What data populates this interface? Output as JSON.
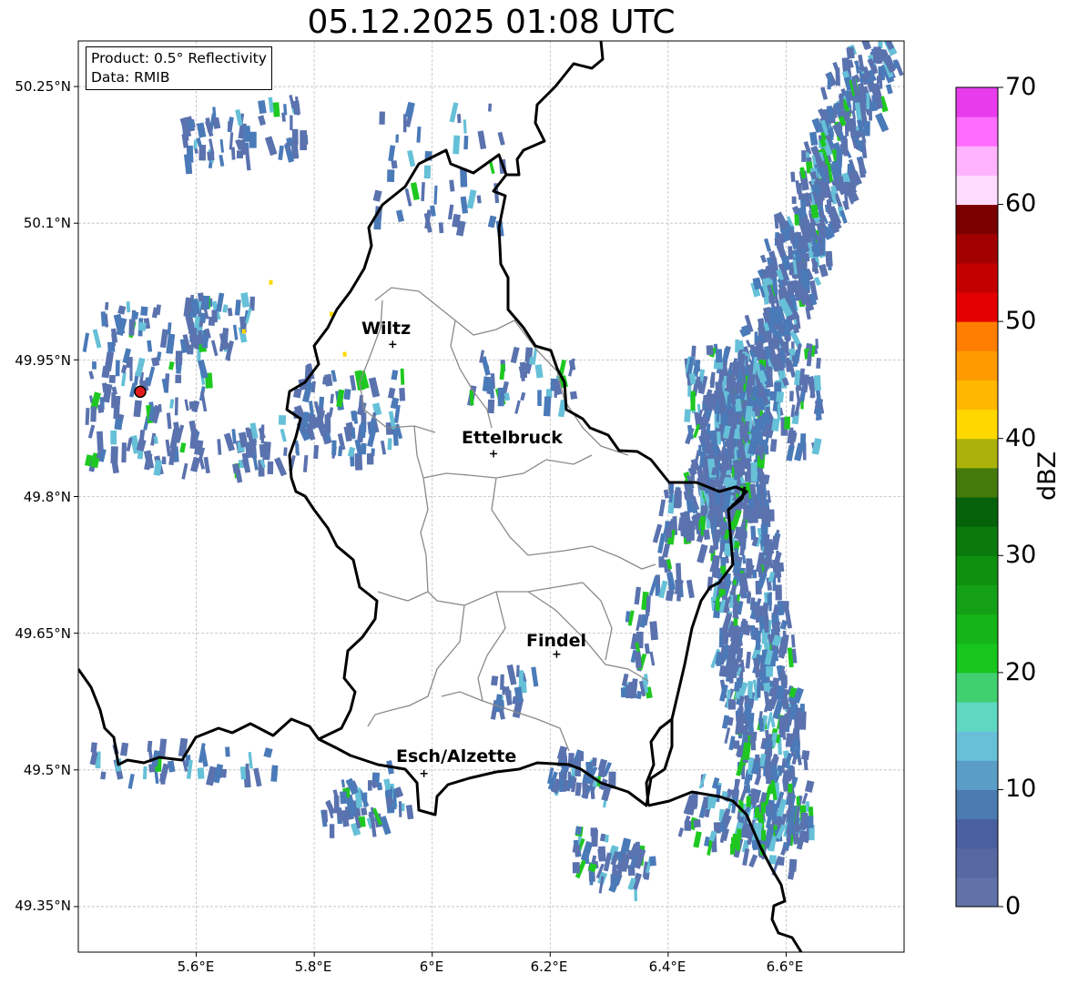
{
  "title": "05.12.2025 01:08 UTC",
  "info_box": {
    "product": "Product: 0.5° Reflectivity",
    "data": "Data: RMIB"
  },
  "lat_labels": [
    "50.25°N",
    "50.1°N",
    "49.95°N",
    "49.8°N",
    "49.65°N",
    "49.5°N",
    "49.35°N"
  ],
  "lon_labels": [
    "5.6°E",
    "5.8°E",
    "6°E",
    "6.2°E",
    "6.4°E",
    "6.6°E"
  ],
  "cities": [
    {
      "name": "Wiltz",
      "lat": 49.967,
      "lon": 5.933
    },
    {
      "name": "Ettelbruck",
      "lat": 49.847,
      "lon": 6.104
    },
    {
      "name": "Findel",
      "lat": 49.627,
      "lon": 6.211
    },
    {
      "name": "Esch/Alzette",
      "lat": 49.496,
      "lon": 5.986
    }
  ],
  "radar_site": {
    "lat": 49.915,
    "lon": 5.505
  },
  "map_extent": {
    "lon_min": 5.4,
    "lon_max": 6.8,
    "lat_min": 49.3,
    "lat_max": 50.3
  },
  "colorbar": {
    "label": "dBZ",
    "ticks": [
      "0",
      "10",
      "20",
      "30",
      "40",
      "50",
      "60",
      "70"
    ],
    "colors": [
      "#6272a8",
      "#5568a2",
      "#4a5fa0",
      "#4a7ab0",
      "#5a9ec8",
      "#68c0d8",
      "#5ed8c0",
      "#40d070",
      "#16c61c",
      "#15b418",
      "#14a016",
      "#10900f",
      "#0b7a0c",
      "#06620a",
      "#447a0c",
      "#aab20a",
      "#ffd800",
      "#ffb700",
      "#ff9a00",
      "#ff7d00",
      "#e40000",
      "#c20000",
      "#a20000",
      "#7a0000",
      "#ffdcff",
      "#ffb3ff",
      "#ff6cff",
      "#e83cec"
    ]
  },
  "echo_colors": {
    "light": "#5a72ae",
    "mid": "#4a7ab8",
    "cyan": "#66c0d8",
    "green": "#1ec820",
    "yellow": "#ffd800"
  }
}
